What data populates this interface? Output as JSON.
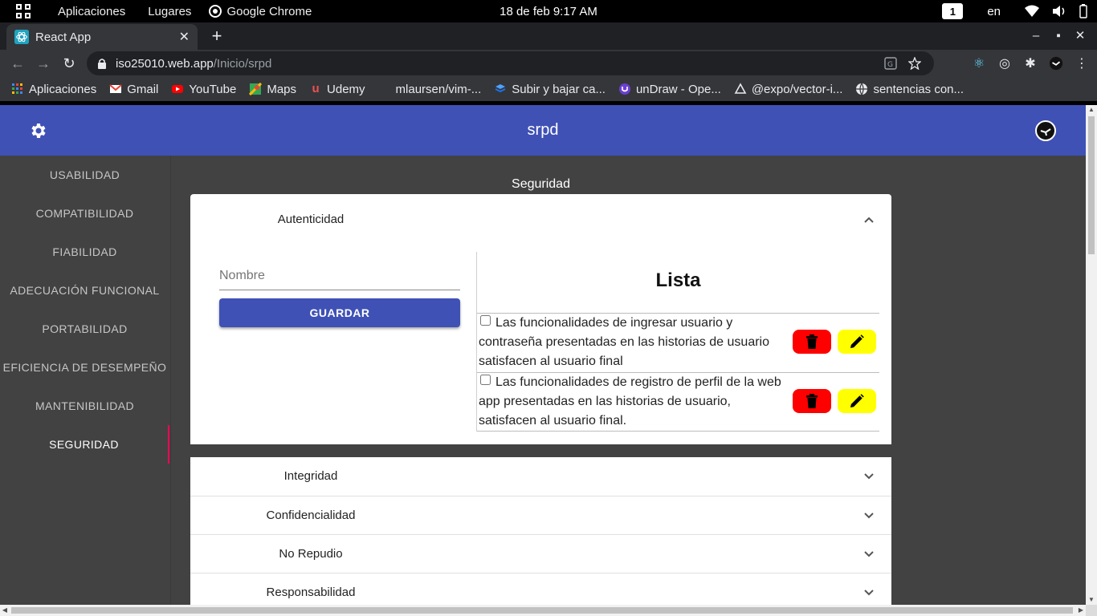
{
  "os_bar": {
    "activities_label": "Aplicaciones",
    "places_label": "Lugares",
    "app_name": "Google Chrome",
    "clock": "18 de feb  9:17 AM",
    "workspace": "1",
    "language": "en"
  },
  "browser": {
    "tab_title": "React App",
    "url_host": "iso25010.web.app",
    "url_path": "/Inicio/srpd",
    "bookmarks": [
      {
        "label": "Aplicaciones",
        "icon": "apps-grid-icon"
      },
      {
        "label": "Gmail",
        "icon": "gmail-icon"
      },
      {
        "label": "YouTube",
        "icon": "youtube-icon"
      },
      {
        "label": "Maps",
        "icon": "maps-icon"
      },
      {
        "label": "Udemy",
        "icon": "udemy-icon"
      },
      {
        "label": "mlaursen/vim-...",
        "icon": "github-icon"
      },
      {
        "label": "Subir y bajar ca...",
        "icon": "blue-cube-icon"
      },
      {
        "label": "unDraw - Ope...",
        "icon": "undraw-icon"
      },
      {
        "label": "@expo/vector-i...",
        "icon": "expo-icon"
      },
      {
        "label": "sentencias con...",
        "icon": "globe-icon"
      }
    ]
  },
  "app": {
    "title": "srpd",
    "sidebar": [
      {
        "label": "USABILIDAD",
        "active": false
      },
      {
        "label": "COMPATIBILIDAD",
        "active": false
      },
      {
        "label": "FIABILIDAD",
        "active": false
      },
      {
        "label": "ADECUACIÓN FUNCIONAL",
        "active": false
      },
      {
        "label": "PORTABILIDAD",
        "active": false
      },
      {
        "label": "EFICIENCIA DE DESEMPEÑO",
        "active": false
      },
      {
        "label": "MANTENIBILIDAD",
        "active": false
      },
      {
        "label": "SEGURIDAD",
        "active": true
      }
    ],
    "section_title": "Seguridad",
    "expanded_panel": {
      "title": "Autenticidad",
      "name_placeholder": "Nombre",
      "save_label": "GUARDAR",
      "list_title": "Lista",
      "items": [
        {
          "text": "Las funcionalidades de ingresar usuario y contraseña presentadas en las historias de usuario satisfacen al usuario final",
          "checked": false
        },
        {
          "text": "Las funcionalidades de registro de perfil de la web app presentadas en las historias de usuario, satisfacen al usuario final.",
          "checked": false
        }
      ]
    },
    "collapsed_panels": [
      "Integridad",
      "Confidencialidad",
      "No Repudio",
      "Responsabilidad"
    ]
  },
  "colors": {
    "app_bar": "#3f51b5",
    "background": "#424242",
    "active_indicator": "#f50057",
    "delete_button": "#ff0000",
    "edit_button": "#ffff00"
  }
}
